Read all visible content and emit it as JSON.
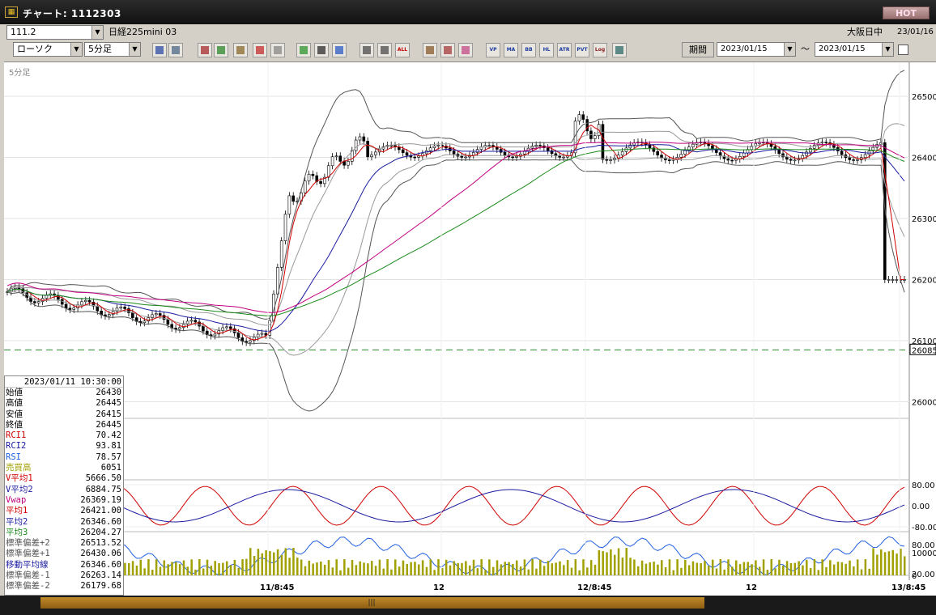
{
  "window": {
    "title": "チャート: 1112303",
    "hot_label": "HOT"
  },
  "toolbar1": {
    "code": "111.2",
    "name": "日経225mini 03",
    "session": "大阪日中",
    "date": "23/01/16"
  },
  "toolbar2": {
    "chart_type": "ローソク",
    "interval": "5分足",
    "period_label": "期間",
    "date_from": "2023/01/15",
    "tilde": "〜",
    "date_to": "2023/01/15",
    "icons": [
      "magnify-icon",
      "crosshair-icon",
      "indicator-icon",
      "zoom-icon",
      "bar-icon",
      "candle-icon",
      "lock-icon",
      "line-draw-icon",
      "pointer-icon",
      "erase-icon",
      "compare-icon",
      "compare2-icon",
      "all-icon",
      "settings-icon",
      "tool-icon",
      "palette-icon",
      "vp-icon",
      "ma-icon",
      "bb-icon",
      "hl-icon",
      "atr-icon",
      "pvt-icon",
      "log-icon",
      "export-icon"
    ],
    "icon_texts": [
      "",
      "",
      "",
      "",
      "",
      "",
      "",
      "",
      "",
      "",
      "",
      "",
      "ALL",
      "",
      "",
      "",
      "VP",
      "MA",
      "BB",
      "HL",
      "ATR",
      "PVT",
      "Log",
      ""
    ]
  },
  "chart": {
    "panel_label": "5分足",
    "price_labels": [
      "26500",
      "26400",
      "26300",
      "26200",
      "26100",
      "26000"
    ],
    "current_price": "26085",
    "rci_labels": [
      "80.00",
      "0.00",
      "-80.00"
    ],
    "rsi_labels": [
      "80.00",
      "20.00"
    ],
    "vol_labels": [
      "10000",
      "0"
    ],
    "x_labels": [
      "11/8:45",
      "12",
      "12/8:45",
      "12",
      "13/8:45"
    ]
  },
  "chart_data": {
    "type": "candlestick",
    "interval": "5分足",
    "price_axis_ticks": [
      26000,
      26100,
      26200,
      26300,
      26400,
      26500
    ],
    "reference_price": 26085,
    "x_ticks": [
      "11/8:45",
      "12",
      "12/8:45",
      "12",
      "13/8:45"
    ]
  },
  "info": {
    "datetime": "2023/01/11  10:30:00",
    "rows": [
      {
        "name": "始値",
        "value": "26430",
        "color": "#000000"
      },
      {
        "name": "高値",
        "value": "26445",
        "color": "#000000"
      },
      {
        "name": "安値",
        "value": "26415",
        "color": "#000000"
      },
      {
        "name": "終値",
        "value": "26445",
        "color": "#000000"
      },
      {
        "name": "RCI1",
        "value": "70.42",
        "color": "#d00000"
      },
      {
        "name": "RCI2",
        "value": "93.81",
        "color": "#1a1aa0"
      },
      {
        "name": "RSI",
        "value": "78.57",
        "color": "#2060e0"
      },
      {
        "name": "売買高",
        "value": "6051",
        "color": "#a0a000"
      },
      {
        "name": "V平均1",
        "value": "5666.50",
        "color": "#d00000"
      },
      {
        "name": "V平均2",
        "value": "6884.75",
        "color": "#1a1aa0"
      },
      {
        "name": "Vwap",
        "value": "26369.19",
        "color": "#c00080"
      },
      {
        "name": "平均1",
        "value": "26421.00",
        "color": "#d00000"
      },
      {
        "name": "平均2",
        "value": "26346.60",
        "color": "#1a1aa0"
      },
      {
        "name": "平均3",
        "value": "26204.27",
        "color": "#1a8a1a"
      },
      {
        "name": "標準偏差+2",
        "value": "26513.52",
        "color": "#555555"
      },
      {
        "name": "標準偏差+1",
        "value": "26430.06",
        "color": "#555555"
      },
      {
        "name": "移動平均線",
        "value": "26346.60",
        "color": "#1a1aa0"
      },
      {
        "name": "標準偏差-1",
        "value": "26263.14",
        "color": "#555555"
      },
      {
        "name": "標準偏差-2",
        "value": "26179.68",
        "color": "#555555"
      }
    ]
  }
}
